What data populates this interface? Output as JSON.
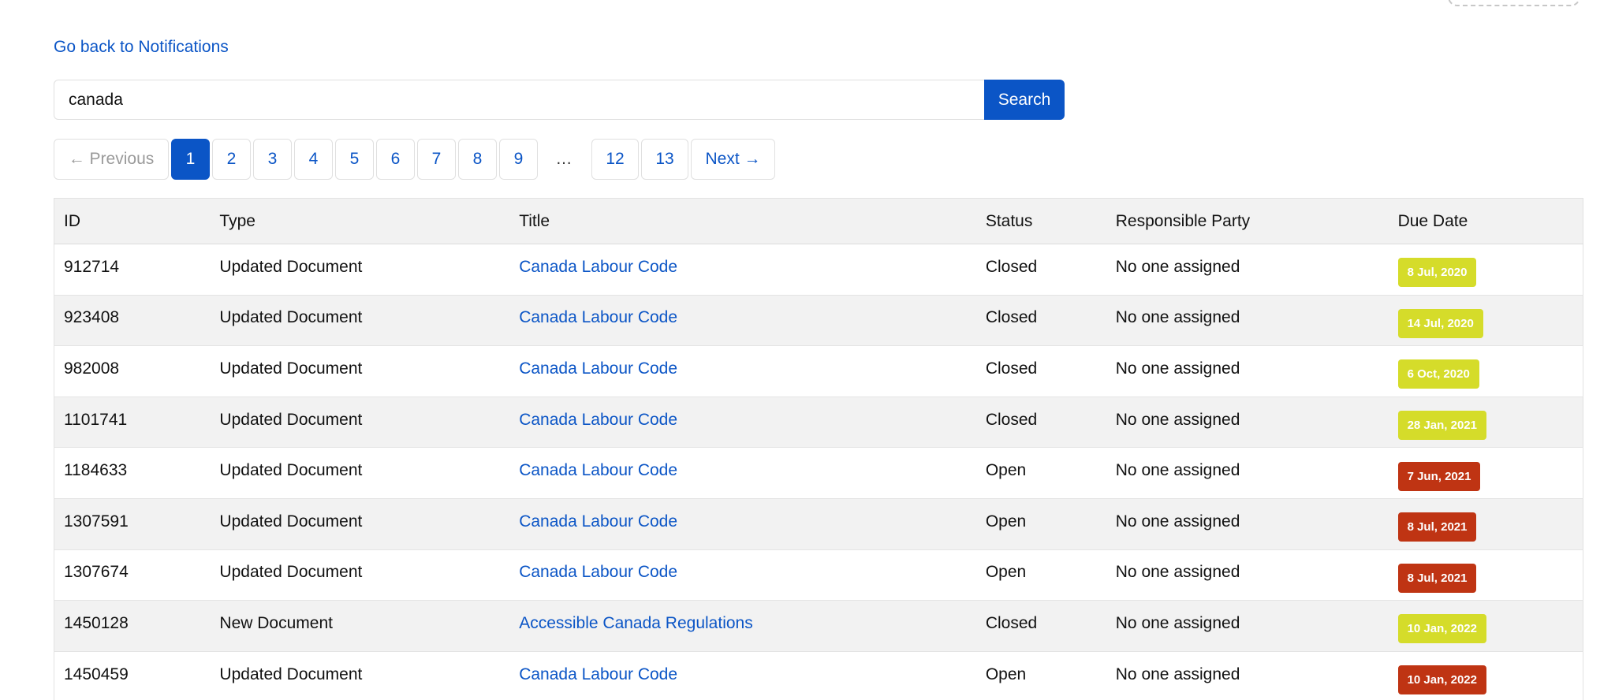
{
  "nav": {
    "back_label": "Go back to Notifications"
  },
  "search": {
    "value": "canada",
    "button_label": "Search"
  },
  "pagination": {
    "previous_label": "← Previous",
    "next_label": "Next →",
    "ellipsis": "…",
    "pages": [
      "1",
      "2",
      "3",
      "4",
      "5",
      "6",
      "7",
      "8",
      "9",
      "12",
      "13"
    ],
    "current": "1"
  },
  "colors": {
    "accent": "#0b55c6",
    "badge_closed": "#d5dc2a",
    "badge_open": "#bf3413"
  },
  "table": {
    "headers": [
      "ID",
      "Type",
      "Title",
      "Status",
      "Responsible Party",
      "Due Date"
    ],
    "rows": [
      {
        "id": "912714",
        "type": "Updated Document",
        "title": "Canada Labour Code",
        "status": "Closed",
        "party": "No one assigned",
        "due": "8 Jul, 2020"
      },
      {
        "id": "923408",
        "type": "Updated Document",
        "title": "Canada Labour Code",
        "status": "Closed",
        "party": "No one assigned",
        "due": "14 Jul, 2020"
      },
      {
        "id": "982008",
        "type": "Updated Document",
        "title": "Canada Labour Code",
        "status": "Closed",
        "party": "No one assigned",
        "due": "6 Oct, 2020"
      },
      {
        "id": "1101741",
        "type": "Updated Document",
        "title": "Canada Labour Code",
        "status": "Closed",
        "party": "No one assigned",
        "due": "28 Jan, 2021"
      },
      {
        "id": "1184633",
        "type": "Updated Document",
        "title": "Canada Labour Code",
        "status": "Open",
        "party": "No one assigned",
        "due": "7 Jun, 2021"
      },
      {
        "id": "1307591",
        "type": "Updated Document",
        "title": "Canada Labour Code",
        "status": "Open",
        "party": "No one assigned",
        "due": "8 Jul, 2021"
      },
      {
        "id": "1307674",
        "type": "Updated Document",
        "title": "Canada Labour Code",
        "status": "Open",
        "party": "No one assigned",
        "due": "8 Jul, 2021"
      },
      {
        "id": "1450128",
        "type": "New Document",
        "title": "Accessible Canada Regulations",
        "status": "Closed",
        "party": "No one assigned",
        "due": "10 Jan, 2022"
      },
      {
        "id": "1450459",
        "type": "Updated Document",
        "title": "Canada Labour Code",
        "status": "Open",
        "party": "No one assigned",
        "due": "10 Jan, 2022"
      }
    ]
  }
}
